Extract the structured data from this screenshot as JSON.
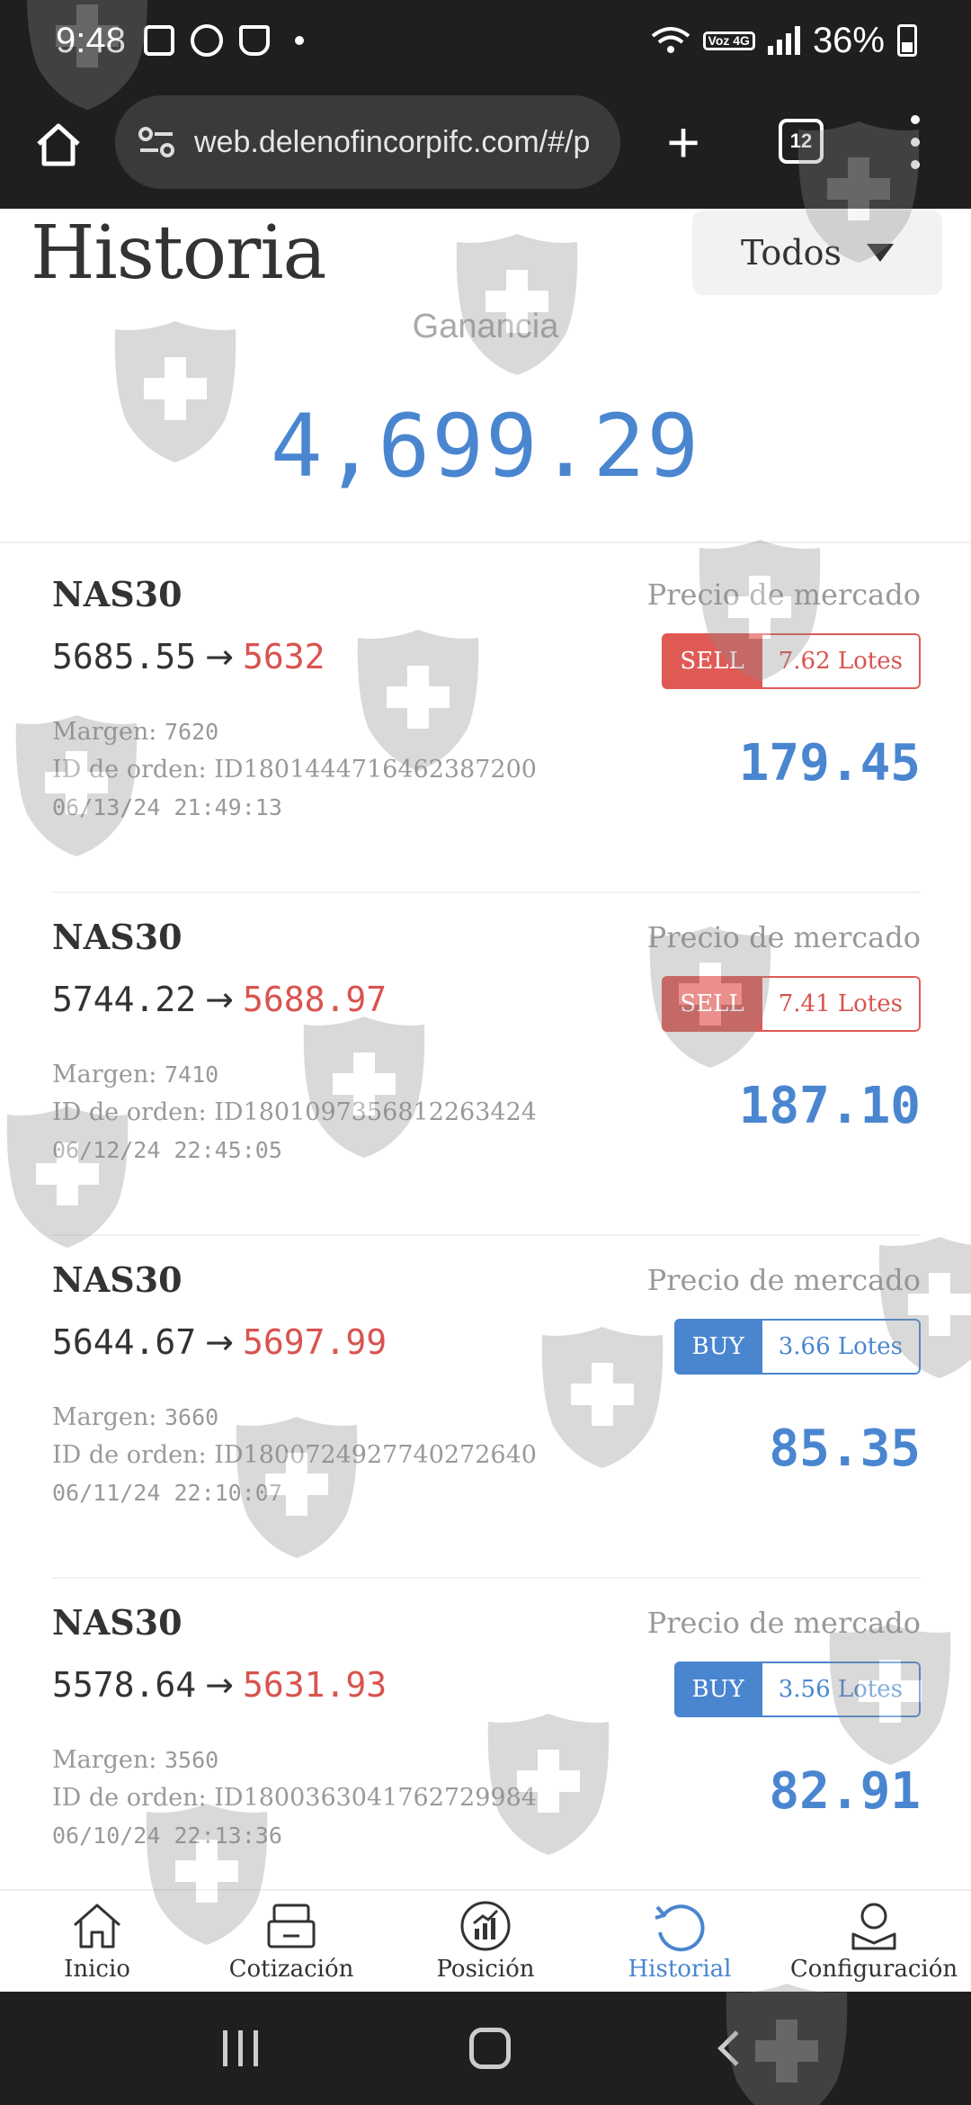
{
  "status_bar": {
    "time": "9:48",
    "battery": "36%",
    "network_badge": "Voz 4G"
  },
  "browser": {
    "url": "web.delenofincorpifc.com/#/p",
    "tab_count": "12"
  },
  "page": {
    "title": "Historia",
    "filter": "Todos",
    "profit_label": "Ganancia",
    "profit_value": "4,699.29"
  },
  "orders": [
    {
      "symbol": "NAS30",
      "market_label": "Precio de mercado",
      "open": "5685.55",
      "close": "5632",
      "side": "SELL",
      "lots": "7.62 Lotes",
      "margin_label": "Margen:",
      "margin": "7620",
      "order_id_label": "ID de orden:",
      "order_id": "ID1801444716462387200",
      "datetime": "06/13/24 21:49:13",
      "pnl": "179.45"
    },
    {
      "symbol": "NAS30",
      "market_label": "Precio de mercado",
      "open": "5744.22",
      "close": "5688.97",
      "side": "SELL",
      "lots": "7.41 Lotes",
      "margin_label": "Margen:",
      "margin": "7410",
      "order_id_label": "ID de orden:",
      "order_id": "ID1801097356812263424",
      "datetime": "06/12/24 22:45:05",
      "pnl": "187.10"
    },
    {
      "symbol": "NAS30",
      "market_label": "Precio de mercado",
      "open": "5644.67",
      "close": "5697.99",
      "side": "BUY",
      "lots": "3.66 Lotes",
      "margin_label": "Margen:",
      "margin": "3660",
      "order_id_label": "ID de orden:",
      "order_id": "ID1800724927740272640",
      "datetime": "06/11/24 22:10:07",
      "pnl": "85.35"
    },
    {
      "symbol": "NAS30",
      "market_label": "Precio de mercado",
      "open": "5578.64",
      "close": "5631.93",
      "side": "BUY",
      "lots": "3.56 Lotes",
      "margin_label": "Margen:",
      "margin": "3560",
      "order_id_label": "ID de orden:",
      "order_id": "ID1800363041762729984",
      "datetime": "06/10/24 22:13:36",
      "pnl": "82.91"
    }
  ],
  "nav": [
    {
      "label": "Inicio",
      "icon": "home-icon"
    },
    {
      "label": "Cotización",
      "icon": "register-icon"
    },
    {
      "label": "Posición",
      "icon": "chart-icon"
    },
    {
      "label": "Historial",
      "icon": "history-icon",
      "active": true
    },
    {
      "label": "Configuración",
      "icon": "user-icon"
    }
  ],
  "colors": {
    "accent": "#4a86d0",
    "sell": "#e05a55",
    "loss_price": "#d9534f",
    "bar_bg": "#1f1f1f"
  }
}
